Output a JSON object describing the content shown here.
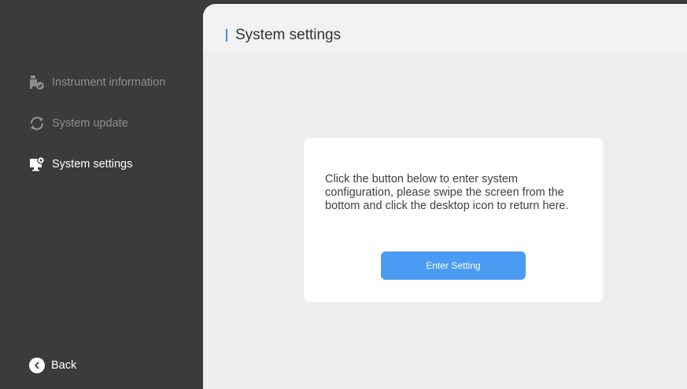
{
  "sidebar": {
    "items": [
      {
        "label": "Instrument information",
        "icon": "instrument-icon",
        "active": false
      },
      {
        "label": "System update",
        "icon": "update-icon",
        "active": false
      },
      {
        "label": "System settings",
        "icon": "settings-monitor-icon",
        "active": true
      }
    ],
    "back_label": "Back"
  },
  "main": {
    "title": "System settings",
    "card": {
      "message": "Click the button below to enter system configuration, please swipe the screen from the bottom and click the desktop icon to return here.",
      "button_label": "Enter Setting"
    }
  },
  "colors": {
    "sidebar_bg": "#3b3b3b",
    "accent": "#3d8bf0",
    "button": "#4a9bf2",
    "content_bg": "#eeeeee"
  }
}
